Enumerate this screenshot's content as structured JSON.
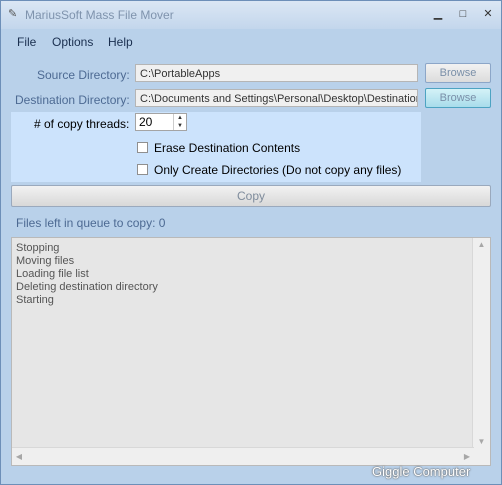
{
  "window": {
    "title": "MariusSoft Mass File Mover",
    "minimize_glyph": "▁",
    "maximize_glyph": "□",
    "close_glyph": "✕",
    "app_icon": "wrench-icon"
  },
  "menu": {
    "items": [
      "File",
      "Options",
      "Help"
    ]
  },
  "source": {
    "label": "Source Directory:",
    "value": "C:\\PortableApps",
    "browse_label": "Browse"
  },
  "destination": {
    "label": "Destination Directory:",
    "value": "C:\\Documents and Settings\\Personal\\Desktop\\Destination",
    "browse_label": "Browse"
  },
  "threads": {
    "label": "# of copy threads:",
    "value": "20"
  },
  "options": {
    "erase_label": "Erase Destination Contents",
    "erase_checked": false,
    "only_dirs_label": "Only Create Directories (Do not copy any files)",
    "only_dirs_checked": false
  },
  "copy_button": "Copy",
  "queue": {
    "label": "Files left in queue to copy:",
    "count": "0"
  },
  "log": {
    "lines": [
      "Stopping",
      "Moving files",
      "Loading file list",
      "Deleting destination directory",
      "Starting"
    ]
  },
  "watermark": "Giggle Computer",
  "colors": {
    "window_bg": "#b9d1ea",
    "panel_bg": "#cce3fc",
    "highlight_button": "#a8dceb"
  }
}
